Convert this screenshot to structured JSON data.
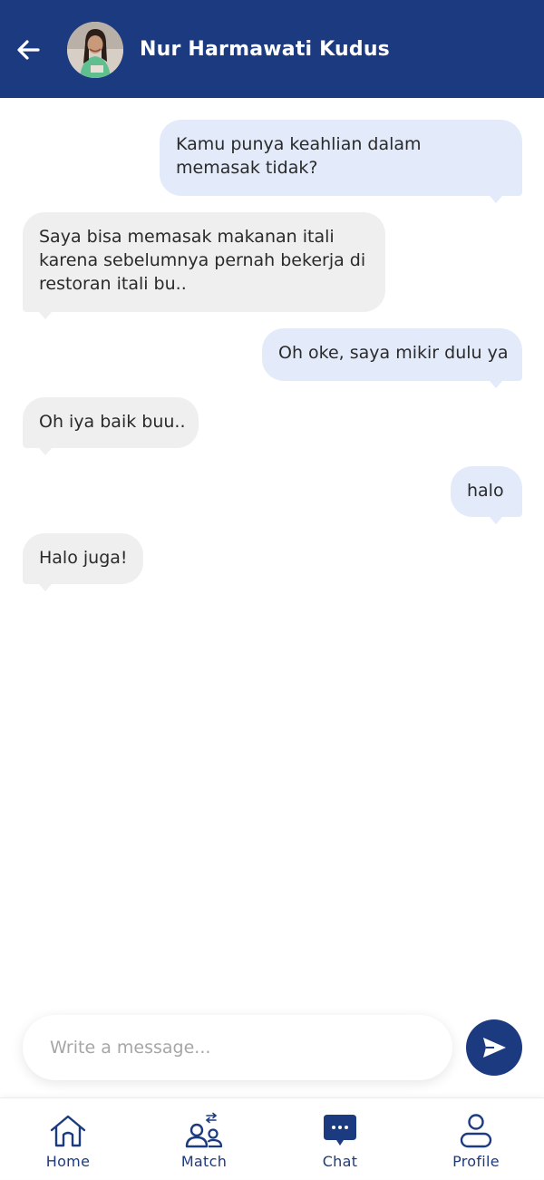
{
  "header": {
    "title": "Nur Harmawati Kudus"
  },
  "messages": [
    {
      "side": "sent",
      "text": "Kamu punya keahlian dalam memasak tidak?"
    },
    {
      "side": "recv",
      "text": "Saya bisa memasak makanan itali karena sebelumnya pernah bekerja di restoran itali bu.."
    },
    {
      "side": "sent",
      "text": "Oh oke, saya mikir dulu ya"
    },
    {
      "side": "recv",
      "text": "Oh iya baik buu.."
    },
    {
      "side": "sent",
      "text": "halo"
    },
    {
      "side": "recv",
      "text": "Halo juga!"
    }
  ],
  "composer": {
    "placeholder": "Write a message...",
    "value": ""
  },
  "nav": {
    "items": [
      {
        "label": "Home",
        "icon": "home-icon"
      },
      {
        "label": "Match",
        "icon": "match-icon"
      },
      {
        "label": "Chat",
        "icon": "chat-icon",
        "active": true
      },
      {
        "label": "Profile",
        "icon": "profile-icon"
      }
    ]
  },
  "colors": {
    "primary": "#1c3a80",
    "sent_bubble": "#e3ebfb",
    "received_bubble": "#efefef"
  }
}
